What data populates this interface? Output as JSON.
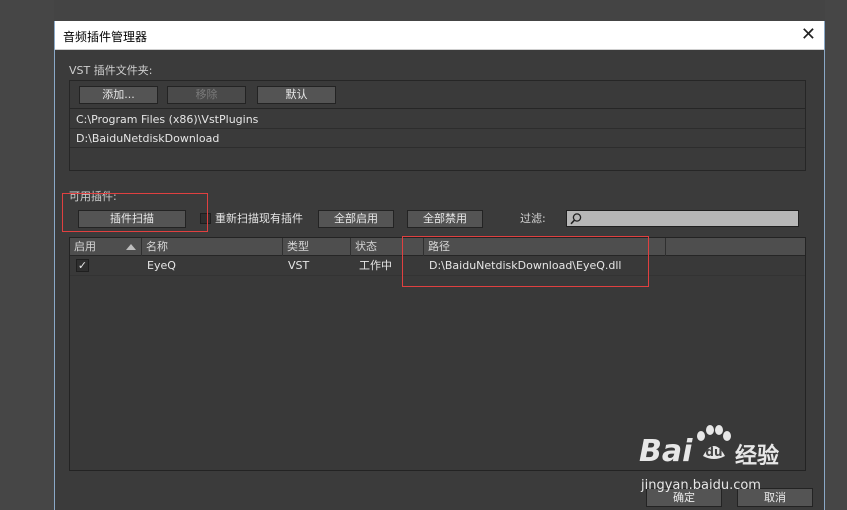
{
  "dialog": {
    "title": "音频插件管理器",
    "close_label": "✕"
  },
  "vst": {
    "section_label": "VST 插件文件夹:",
    "buttons": {
      "add": "添加...",
      "remove": "移除",
      "default": "默认"
    },
    "folders": [
      "C:\\Program Files (x86)\\VstPlugins",
      "D:\\BaiduNetdiskDownload"
    ]
  },
  "plugins": {
    "section_label": "可用插件:",
    "buttons": {
      "scan": "插件扫描",
      "enable_all": "全部启用",
      "disable_all": "全部禁用"
    },
    "rescan_label": "重新扫描现有插件",
    "filter_label": "过滤:",
    "filter_value": "",
    "columns": [
      "启用",
      "名称",
      "类型",
      "状态",
      "路径"
    ],
    "rows": [
      {
        "enabled": "✓",
        "name": "EyeQ",
        "type": "VST",
        "status": "工作中",
        "path": "D:\\BaiduNetdiskDownload\\EyeQ.dll"
      }
    ]
  },
  "footer": {
    "ok": "确定",
    "cancel": "取消"
  },
  "watermark": {
    "brand": "Bai",
    "brand_suffix": "经验",
    "url": "jingyan.baidu.com"
  },
  "colors": {
    "highlight": "#e04040",
    "dialog_bg": "#3b3b3b",
    "titlebar_bg": "#ffffff"
  }
}
